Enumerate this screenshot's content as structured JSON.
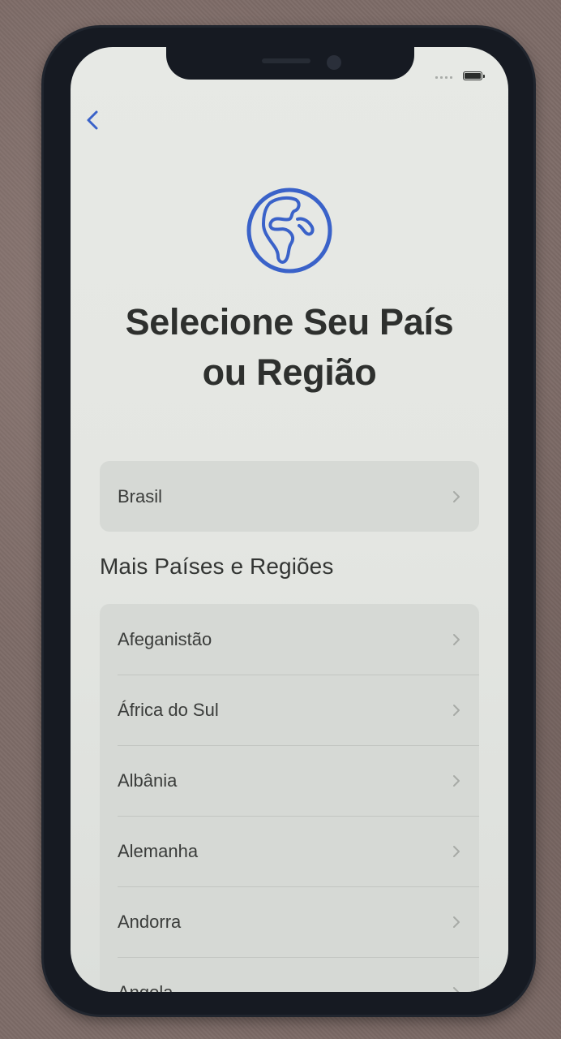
{
  "screen": {
    "title": "Selecione Seu País ou Região",
    "title_line1": "Selecione Seu País",
    "title_line2": "ou Região"
  },
  "icons": {
    "back": "chevron-left-icon",
    "globe": "globe-icon",
    "row_chevron": "chevron-right-icon"
  },
  "suggested": {
    "items": [
      {
        "label": "Brasil"
      }
    ]
  },
  "more": {
    "header": "Mais Países e Regiões",
    "items": [
      {
        "label": "Afeganistão"
      },
      {
        "label": "África do Sul"
      },
      {
        "label": "Albânia"
      },
      {
        "label": "Alemanha"
      },
      {
        "label": "Andorra"
      },
      {
        "label": "Angola"
      }
    ]
  },
  "colors": {
    "accent": "#3a62c9",
    "screen_bg": "#e5e7e3",
    "row_bg": "#d6d9d5",
    "text": "#2e302e"
  }
}
